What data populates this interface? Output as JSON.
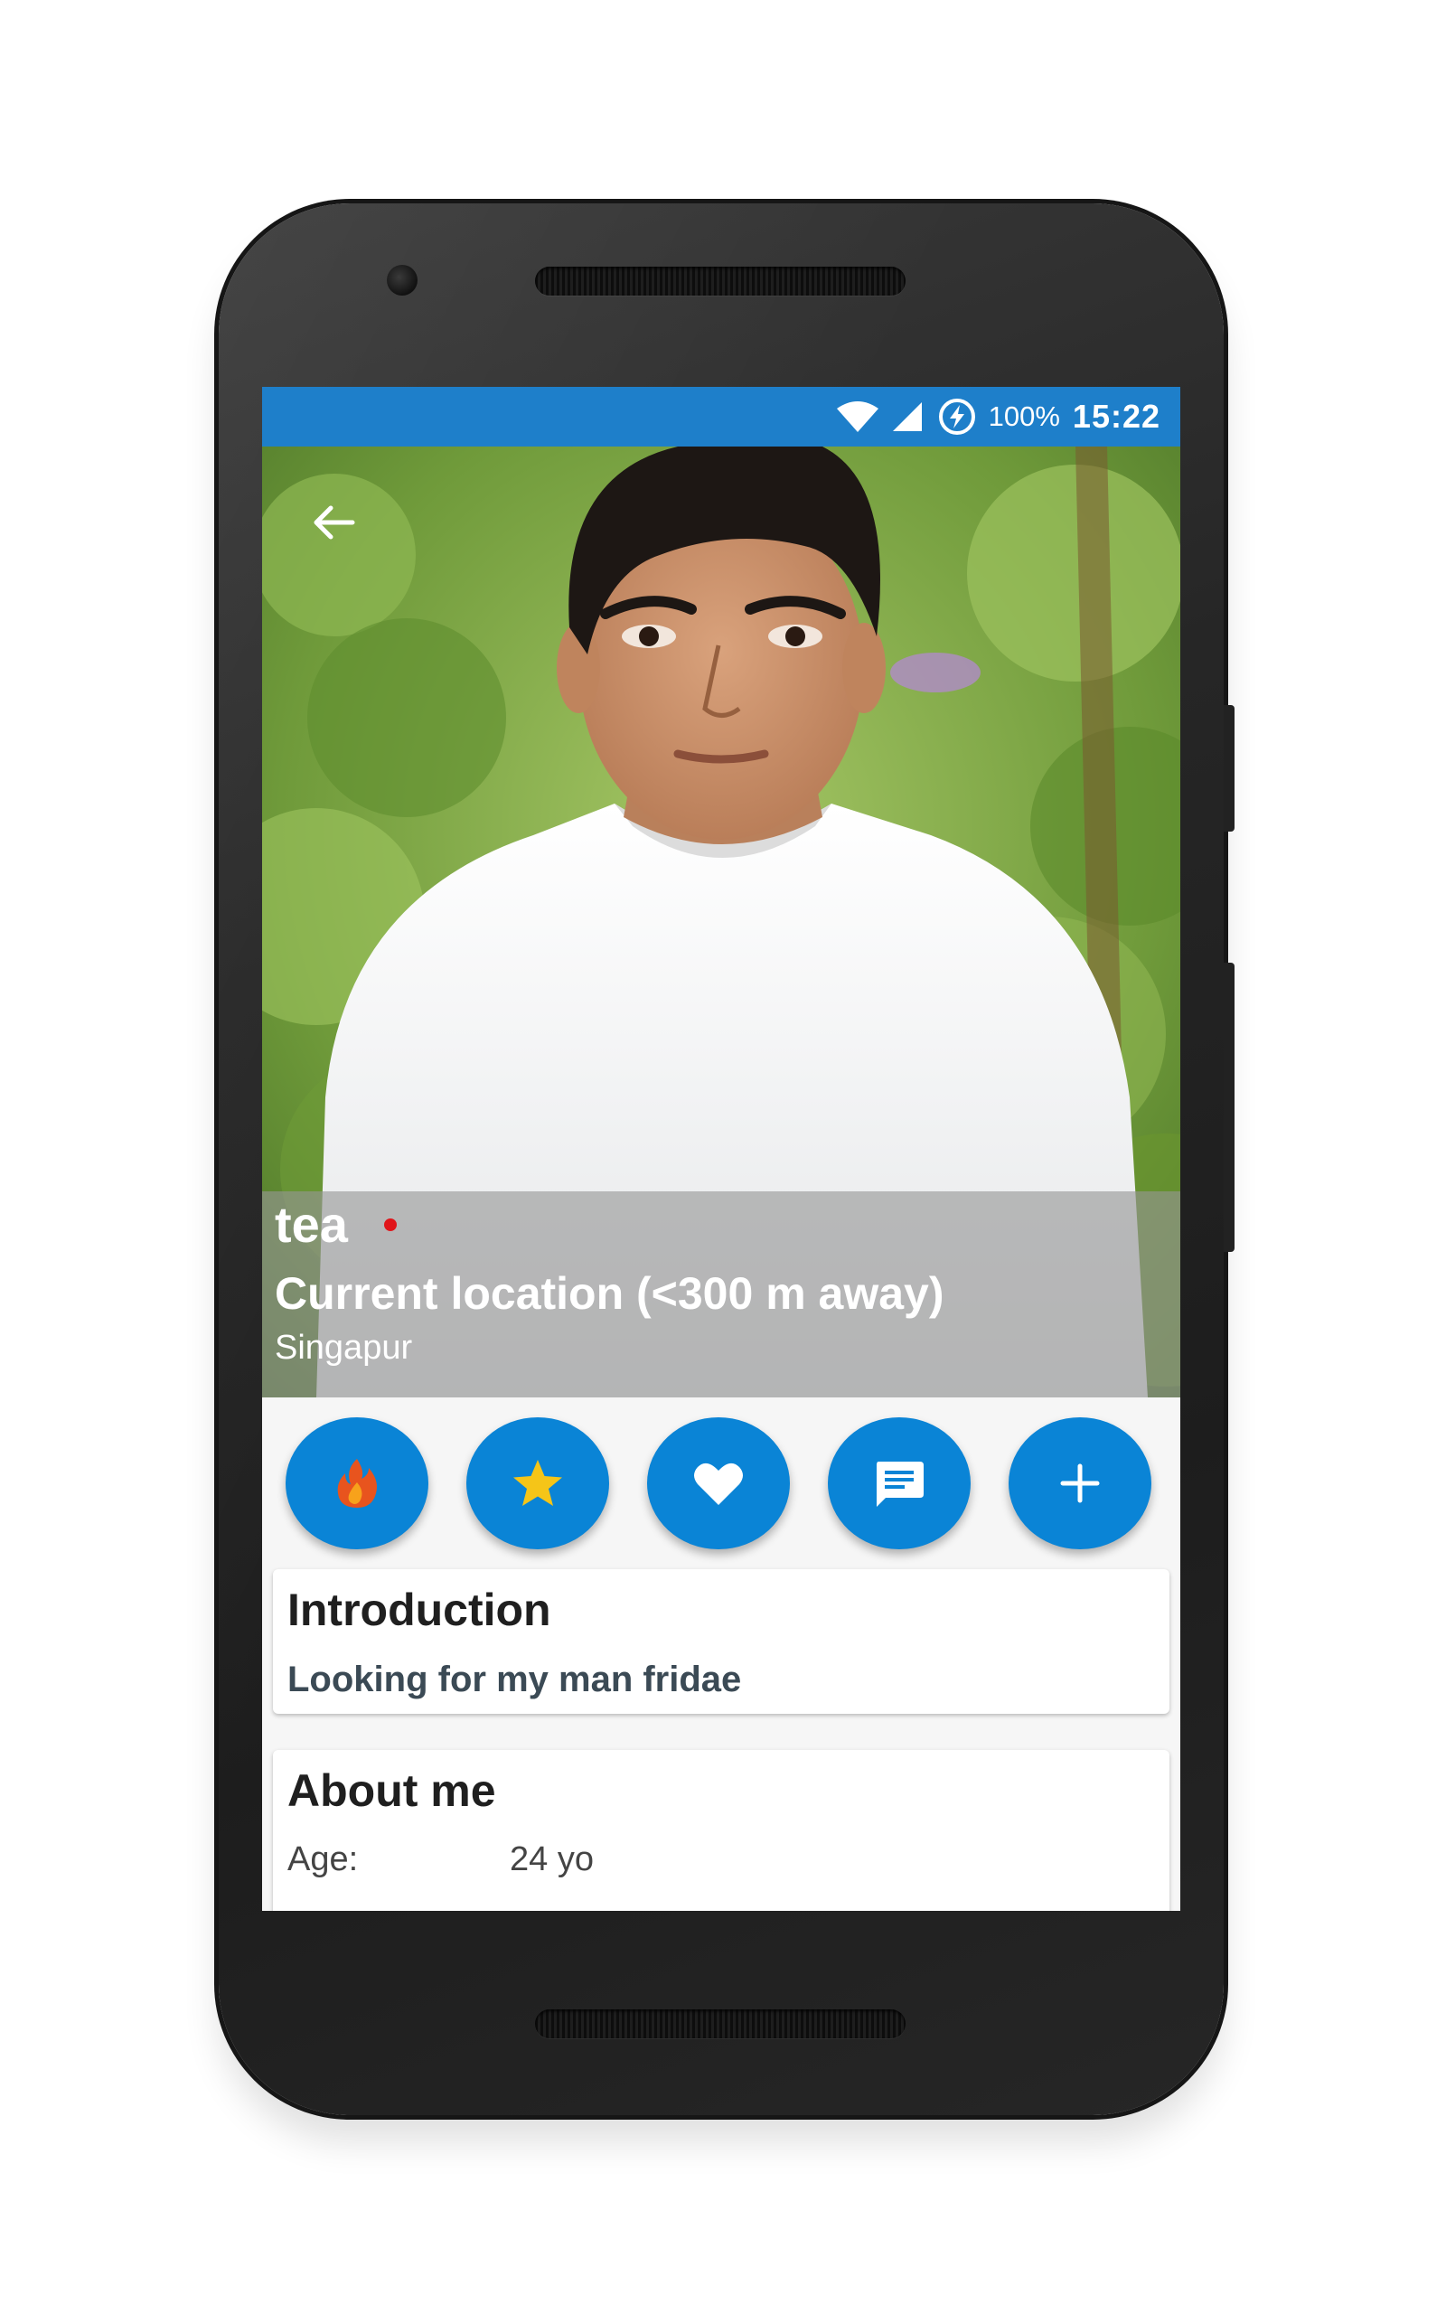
{
  "status_bar": {
    "battery": "100%",
    "time": "15:22",
    "icons": [
      "wifi-icon",
      "signal-icon",
      "battery-charging-icon"
    ]
  },
  "profile": {
    "name": "tea",
    "location": "Current location (<300 m away)",
    "city": "Singapur"
  },
  "actions": [
    {
      "name": "flame-button",
      "icon": "flame-icon"
    },
    {
      "name": "favorite-button",
      "icon": "star-icon"
    },
    {
      "name": "like-button",
      "icon": "heart-icon"
    },
    {
      "name": "message-button",
      "icon": "chat-icon"
    },
    {
      "name": "more-button",
      "icon": "plus-icon"
    }
  ],
  "introduction": {
    "title": "Introduction",
    "text": "Looking for my man fridae"
  },
  "about": {
    "title": "About me",
    "rows": [
      {
        "label": "Age:",
        "value": "24 yo"
      }
    ]
  },
  "colors": {
    "status_bar": "#1e7fca",
    "action_button": "#0a84d6",
    "online_dot": "#e0151a"
  }
}
